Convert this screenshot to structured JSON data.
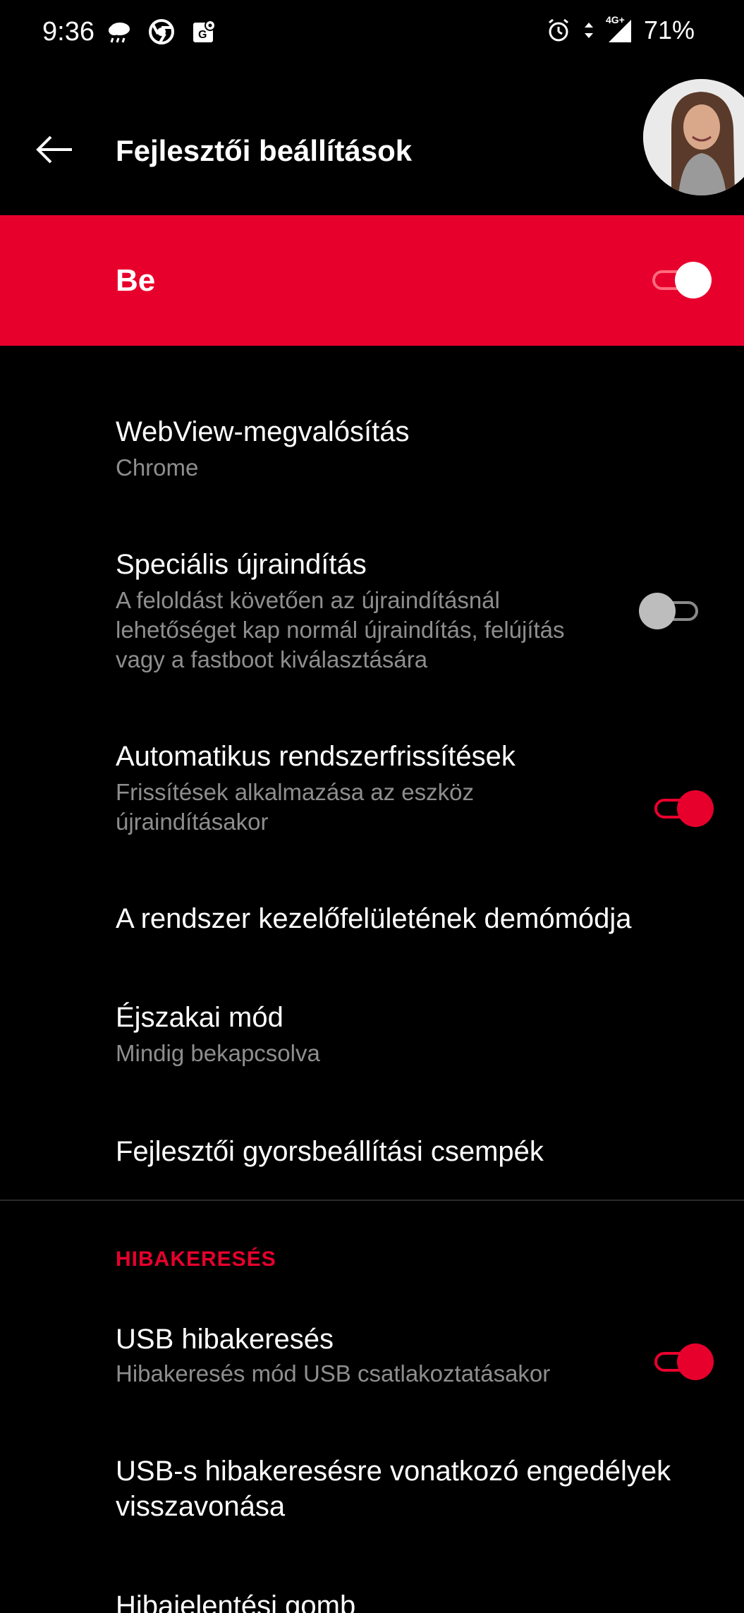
{
  "status_bar": {
    "time": "9:36",
    "network": "4G+",
    "battery": "71%"
  },
  "header": {
    "title": "Fejlesztői beállítások"
  },
  "master_switch": {
    "label": "Be",
    "on": true
  },
  "settings": {
    "webview": {
      "title": "WebView-megvalósítás",
      "subtitle": "Chrome"
    },
    "advanced_reboot": {
      "title": "Speciális újraindítás",
      "subtitle_lines": [
        "A feloldást követően az újraindításnál",
        "lehetőséget kap normál újraindítás, felújítás",
        "vagy a fastboot kiválasztására"
      ],
      "on": false
    },
    "auto_updates": {
      "title": "Automatikus rendszerfrissítések",
      "subtitle_lines": [
        "Frissítések alkalmazása az eszköz",
        "újraindításakor"
      ],
      "on": true
    },
    "demo_mode": {
      "title": "A rendszer kezelőfelületének demómódja"
    },
    "night_mode": {
      "title": "Éjszakai mód",
      "subtitle": "Mindig bekapcsolva"
    },
    "quick_tiles": {
      "title": "Fejlesztői gyorsbeállítási csempék"
    }
  },
  "debug_section": {
    "header": "HIBAKERESÉS",
    "usb_debugging": {
      "title": "USB hibakeresés",
      "subtitle": "Hibakeresés mód USB csatlakoztatásakor",
      "on": true
    },
    "revoke_usb": {
      "title_lines": [
        "USB-s hibakeresésre vonatkozó engedélyek",
        "visszavonása"
      ]
    },
    "bug_report": {
      "title": "Hibajelentési gomb"
    }
  },
  "colors": {
    "accent": "#e8002d",
    "background": "#000000",
    "secondary_text": "#8e8e8e"
  },
  "icons": [
    "weather-icon",
    "chrome-icon",
    "maps-icon",
    "alarm-icon",
    "data-arrows-icon",
    "signal-icon",
    "back-arrow-icon"
  ]
}
